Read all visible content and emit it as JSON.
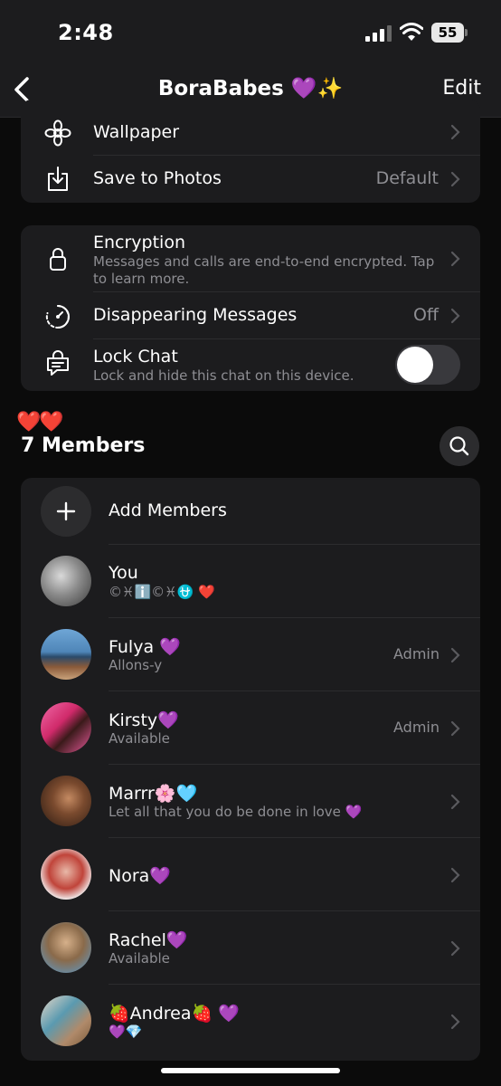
{
  "status": {
    "time": "2:48",
    "battery": "55"
  },
  "nav": {
    "title": "BoraBabes 💜✨",
    "edit": "Edit"
  },
  "media_card": {
    "wallpaper": "Wallpaper",
    "save_photos": "Save to Photos",
    "save_photos_value": "Default"
  },
  "privacy_card": {
    "encryption": "Encryption",
    "encryption_sub": "Messages and calls are end-to-end encrypted. Tap to learn more.",
    "disappearing": "Disappearing Messages",
    "disappearing_value": "Off",
    "lock_chat": "Lock Chat",
    "lock_chat_sub": "Lock and hide this chat on this device.",
    "lock_chat_on": false
  },
  "members": {
    "hearts": "❤️❤️",
    "title": "7 Members",
    "add_label": "Add Members",
    "list": [
      {
        "name": "You",
        "status": "©♓ℹ️©♓⛎ ❤️",
        "role": ""
      },
      {
        "name": "Fulya 💜",
        "status": "Allons-y",
        "role": "Admin"
      },
      {
        "name": "Kirsty💜",
        "status": "Available",
        "role": "Admin"
      },
      {
        "name": "Marrr🌸🩵",
        "status": "Let all that you do be done in love 💜",
        "role": ""
      },
      {
        "name": "Nora💜",
        "status": "",
        "role": ""
      },
      {
        "name": "Rachel💜",
        "status": "Available",
        "role": ""
      },
      {
        "name": "🍓Andrea🍓 💜",
        "status": "💜💎",
        "role": ""
      }
    ]
  },
  "colors": {
    "background": "#0b0b0b",
    "card": "#1c1c1e",
    "secondary_text": "#8e8e93",
    "separator": "#2c2c2e"
  }
}
